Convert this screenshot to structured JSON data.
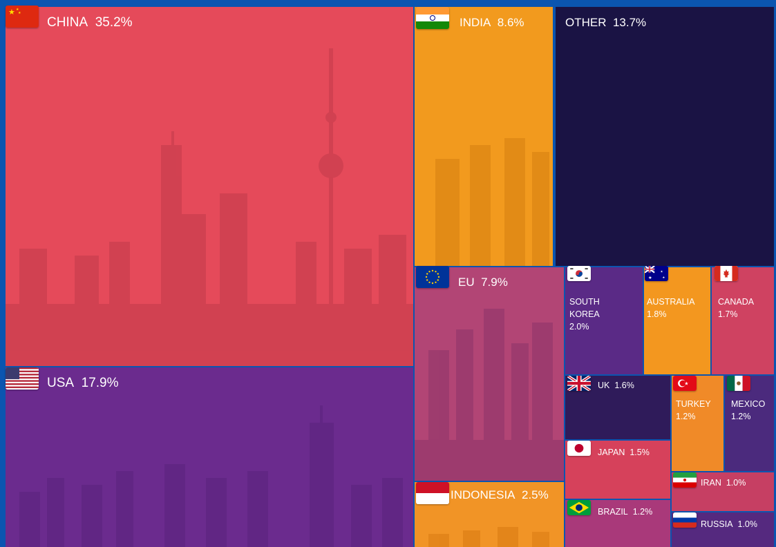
{
  "chart_data": {
    "type": "treemap",
    "items": [
      {
        "key": "china",
        "label": "CHINA",
        "value": 35.2,
        "pct": "35.2%",
        "color": "#e54a5a",
        "flag": "china-flag-icon"
      },
      {
        "key": "usa",
        "label": "USA",
        "value": 17.9,
        "pct": "17.9%",
        "color": "#6b2b8e",
        "flag": "usa-flag-icon"
      },
      {
        "key": "india",
        "label": "INDIA",
        "value": 8.6,
        "pct": "8.6%",
        "color": "#f29a1e",
        "flag": "india-flag-icon"
      },
      {
        "key": "other",
        "label": "OTHER",
        "value": 13.7,
        "pct": "13.7%",
        "color": "#1a1344",
        "flag": ""
      },
      {
        "key": "eu",
        "label": "EU",
        "value": 7.9,
        "pct": "7.9%",
        "color": "#b24575",
        "flag": "eu-flag-icon"
      },
      {
        "key": "indonesia",
        "label": "INDONESIA",
        "value": 2.5,
        "pct": "2.5%",
        "color": "#f19426",
        "flag": "indonesia-flag-icon"
      },
      {
        "key": "south_korea",
        "label": "SOUTH KOREA",
        "value": 2.0,
        "pct": "2.0%",
        "color": "#5a2a86",
        "flag": "south-korea-flag-icon"
      },
      {
        "key": "australia",
        "label": "AUSTRALIA",
        "value": 1.8,
        "pct": "1.8%",
        "color": "#f3971f",
        "flag": "australia-flag-icon"
      },
      {
        "key": "canada",
        "label": "CANADA",
        "value": 1.7,
        "pct": "1.7%",
        "color": "#cf4261",
        "flag": "canada-flag-icon"
      },
      {
        "key": "uk",
        "label": "UK",
        "value": 1.6,
        "pct": "1.6%",
        "color": "#2f1b5a",
        "flag": "uk-flag-icon"
      },
      {
        "key": "turkey",
        "label": "TURKEY",
        "value": 1.2,
        "pct": "1.2%",
        "color": "#f08a28",
        "flag": "turkey-flag-icon"
      },
      {
        "key": "mexico",
        "label": "MEXICO",
        "value": 1.2,
        "pct": "1.2%",
        "color": "#4b2a7d",
        "flag": "mexico-flag-icon"
      },
      {
        "key": "japan",
        "label": "JAPAN",
        "value": 1.5,
        "pct": "1.5%",
        "color": "#d6415b",
        "flag": "japan-flag-icon"
      },
      {
        "key": "iran",
        "label": "IRAN",
        "value": 1.0,
        "pct": "1.0%",
        "color": "#c63f63",
        "flag": "iran-flag-icon"
      },
      {
        "key": "brazil",
        "label": "BRAZIL",
        "value": 1.2,
        "pct": "1.2%",
        "color": "#a9397a",
        "flag": "brazil-flag-icon"
      },
      {
        "key": "russia",
        "label": "RUSSIA",
        "value": 1.0,
        "pct": "1.0%",
        "color": "#55297f",
        "flag": "russia-flag-icon"
      }
    ]
  },
  "colors": {
    "background": "#0b55b0"
  }
}
